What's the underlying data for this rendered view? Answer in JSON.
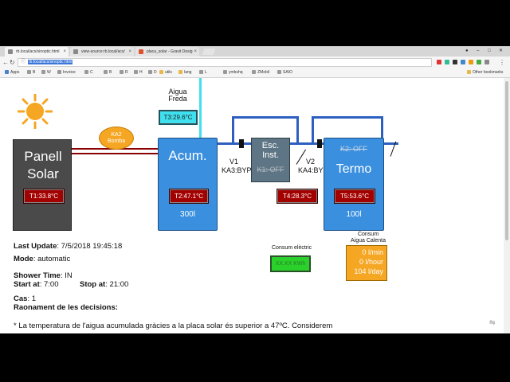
{
  "browser": {
    "tabs": [
      {
        "label": "rb.local/acs/sinoptic.html"
      },
      {
        "label": "view-source:rb.local/acs/"
      },
      {
        "label": "placa_solar - Gravit Desig"
      }
    ],
    "url_selected": "rb.local/acs/sinoptic.html",
    "bookmarks": [
      "Apps",
      "B",
      "W",
      "Invoice",
      "C",
      "B",
      "R",
      "H",
      "D",
      "utils",
      "lang",
      "L",
      "ymbshq",
      "ZMobil",
      "SAIO"
    ],
    "other_bookmarks": "Other bookmarks"
  },
  "diagram": {
    "panel_title_1": "Panell",
    "panel_title_2": "Solar",
    "t1": "T1:33.8°C",
    "pump_1": "KA2",
    "pump_2": "Bomba",
    "cold_water_1": "Aigua",
    "cold_water_2": "Freda",
    "t3": "T3:29.6°C",
    "acum_title": "Acum.",
    "t2": "T2:47.1°C",
    "acum_volume": "300l",
    "v1": "V1",
    "ka3": "KA3:BYPASS",
    "inst_title_1": "Esc.",
    "inst_title_2": "Inst.",
    "k1": "K1: OFF",
    "t4": "T4:28.3°C",
    "v2": "V2",
    "ka4": "KA4:BYPASS",
    "k2": "K2: OFF",
    "termo_title": "Termo",
    "t5": "T5:53.6°C",
    "termo_volume": "100l",
    "consum_electric_label": "Consum elèctric",
    "consum_electric_value": "XX.XX KWh",
    "consum_aigua_label_1": "Consum",
    "consum_aigua_label_2": "Aigua Calenta",
    "consum_aigua_1": "0 l/min",
    "consum_aigua_2": "0 l/hour",
    "consum_aigua_3": "104 l/day"
  },
  "status": {
    "last_update_label": "Last Update",
    "last_update_value": ": 7/5/2018 19:45:18",
    "mode_label": "Mode",
    "mode_value": ": automatic",
    "shower_label": "Shower Time",
    "shower_value": ": IN",
    "start_label": "Start at",
    "start_value": ": 7:00",
    "stop_label": "Stop at",
    "stop_value": ": 21:00",
    "cas_label": "Cas",
    "cas_value": ": 1",
    "reason_label": "Raonament de les decisions:",
    "reason_text": "* La temperatura de l'aigua acumulada gràcies a la placa solar és superior a 47ºC. Considerem"
  },
  "colors": {
    "tank": "#3a8fdf",
    "temp_red": "#a30000",
    "pipe_blue": "#2d5fbf",
    "pump_orange": "#f5a623"
  }
}
